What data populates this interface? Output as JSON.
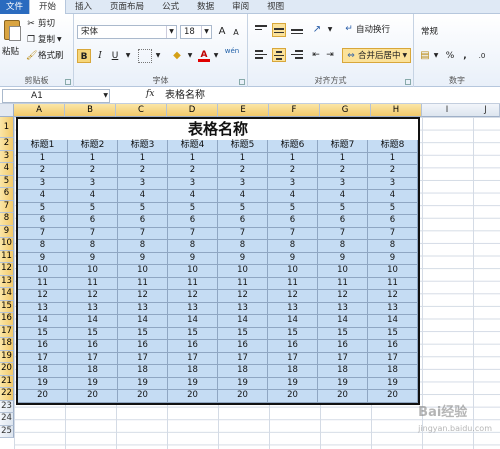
{
  "menu": {
    "tabs": [
      "文件",
      "开始",
      "插入",
      "页面布局",
      "公式",
      "数据",
      "审阅",
      "视图"
    ],
    "active_index": 1
  },
  "ribbon": {
    "clipboard": {
      "paste": "粘贴",
      "cut": "剪切",
      "copy": "复制",
      "format_painter": "格式刷",
      "label": "剪贴板"
    },
    "font": {
      "font_name": "宋体",
      "font_size": "18",
      "grow": "A",
      "shrink": "A",
      "bold": "B",
      "italic": "I",
      "underline": "U",
      "font_color_glyph": "A",
      "phonetic": "wén",
      "label": "字体"
    },
    "alignment": {
      "wrap_text": "自动换行",
      "merge_center": "合并后居中",
      "label": "对齐方式"
    },
    "number": {
      "format": "常规",
      "percent": "%",
      "comma": ",",
      "label": "数字"
    }
  },
  "formula_bar": {
    "name_box": "A1",
    "fx": "fx",
    "content": "表格名称"
  },
  "sheet": {
    "columns": [
      "A",
      "B",
      "C",
      "D",
      "E",
      "F",
      "G",
      "H",
      "I",
      "J"
    ],
    "rows": [
      "1",
      "2",
      "3",
      "4",
      "5",
      "6",
      "7",
      "8",
      "9",
      "10",
      "11",
      "12",
      "13",
      "14",
      "15",
      "16",
      "17",
      "18",
      "19",
      "20",
      "21",
      "22",
      "23",
      "24",
      "25"
    ],
    "table": {
      "title": "表格名称",
      "headers": [
        "标题1",
        "标题2",
        "标题3",
        "标题4",
        "标题5",
        "标题6",
        "标题7",
        "标题8"
      ],
      "row_values": [
        "1",
        "2",
        "3",
        "4",
        "5",
        "6",
        "7",
        "8",
        "9",
        "10",
        "11",
        "12",
        "13",
        "14",
        "15",
        "16",
        "17",
        "18",
        "19",
        "20"
      ]
    },
    "fill_color": "#c5dcf3",
    "selection_color": "#f2c96a"
  },
  "watermark": {
    "text": "Bai经验",
    "sub": "jingyan.baidu.com"
  }
}
